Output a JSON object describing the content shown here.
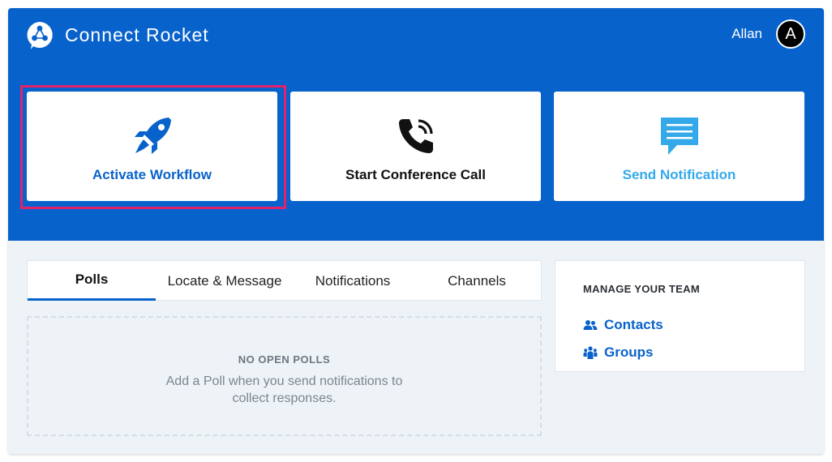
{
  "app": {
    "title": "Connect Rocket"
  },
  "user": {
    "name": "Allan",
    "initial": "A"
  },
  "actions": [
    {
      "label": "Activate Workflow",
      "icon": "rocket-icon",
      "color": "#0862cb",
      "highlighted": true
    },
    {
      "label": "Start Conference Call",
      "icon": "phone-call-icon",
      "color": "#111111"
    },
    {
      "label": "Send Notification",
      "icon": "message-icon",
      "color": "#34a9ea"
    }
  ],
  "tabs": [
    {
      "label": "Polls",
      "active": true
    },
    {
      "label": "Locate & Message"
    },
    {
      "label": "Notifications"
    },
    {
      "label": "Channels"
    }
  ],
  "polls": {
    "empty_title": "NO OPEN POLLS",
    "empty_text": "Add a Poll when you send notifications to collect responses."
  },
  "team": {
    "title": "MANAGE YOUR TEAM",
    "links": [
      {
        "label": "Contacts",
        "icon": "contacts-icon"
      },
      {
        "label": "Groups",
        "icon": "groups-icon"
      }
    ]
  },
  "colors": {
    "brand": "#0862cb",
    "highlight": "#e3226c",
    "accent_light": "#34a9ea",
    "background": "#eef3f7"
  }
}
